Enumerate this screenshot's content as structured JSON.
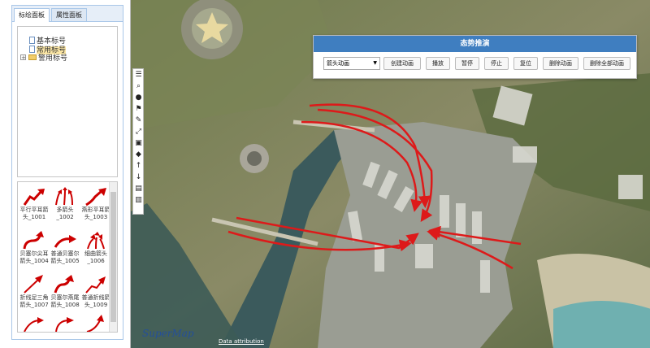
{
  "left_panel": {
    "tabs": [
      "标绘面板",
      "属性面板"
    ],
    "tree": [
      {
        "label": "基本标号",
        "kind": "doc"
      },
      {
        "label": "常用标号",
        "kind": "doc",
        "selected": true
      },
      {
        "label": "警用标号",
        "kind": "folder",
        "expander": "+"
      }
    ],
    "symbols": [
      "平行平耳箭头_1001",
      "多箭头_1002",
      "燕形平耳箭头_1003",
      "贝塞尔尖耳箭头_1004",
      "普通贝塞尔箭头_1005",
      "细曲箭头_1006",
      "折线足三角箭头_1007",
      "贝塞尔燕尾箭头_1008",
      "普通折线箭头_1009",
      "",
      "",
      ""
    ]
  },
  "dialog": {
    "title": "态势推演",
    "select_value": "箭头动画",
    "buttons": [
      "创建动画",
      "播放",
      "暂停",
      "停止",
      "复位",
      "删除动画",
      "删除全部动画"
    ]
  },
  "map": {
    "attribution": "Data attribution",
    "logo": "SuperMap",
    "toolbar_icons": [
      "layers-icon",
      "zoom-icon",
      "globe-icon",
      "flag-icon",
      "wrench-icon",
      "expand-icon",
      "delete-icon",
      "eraser-icon",
      "up-arrow-icon",
      "down-arrow-icon",
      "export-icon",
      "import-icon"
    ]
  },
  "colors": {
    "arrow": "#dd1a1a",
    "dialog_header": "#3f7ec0",
    "water": "#3b5a5c"
  }
}
